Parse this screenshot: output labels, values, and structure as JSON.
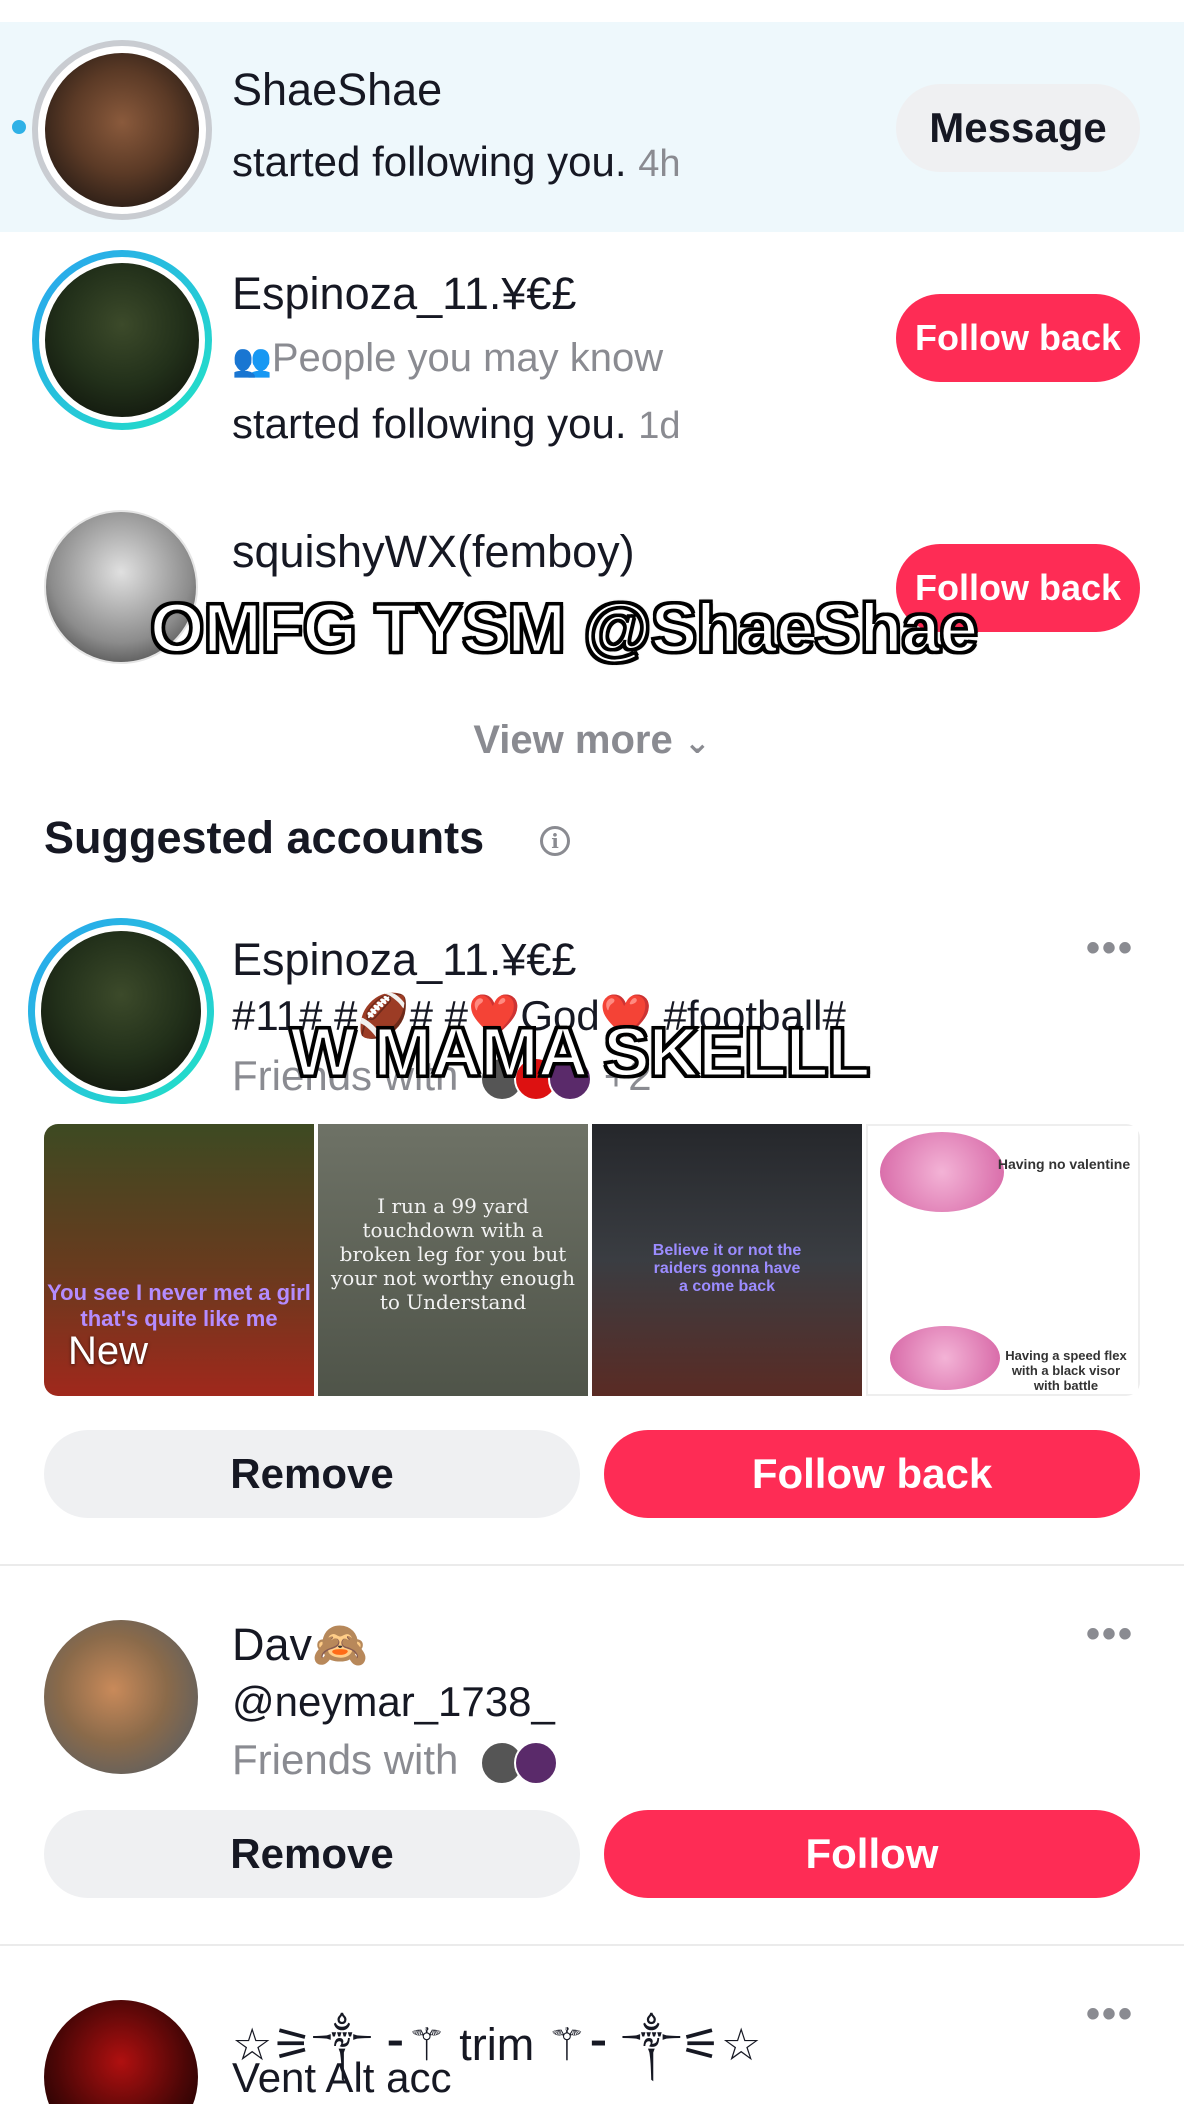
{
  "notifications": [
    {
      "name": "ShaeShae",
      "text": "started following you.",
      "time": "4h",
      "button": "Message"
    },
    {
      "name": "Espinoza_11.¥€£",
      "context": "People you may know",
      "text": "started following you.",
      "time": "1d",
      "button": "Follow back"
    },
    {
      "name": "squishyWX(femboy)",
      "button": "Follow back"
    }
  ],
  "view_more": "View more",
  "suggested": {
    "title": "Suggested accounts",
    "accounts": [
      {
        "name": "Espinoza_11.¥€£",
        "bio": "#11# #🏈# #❤️God❤️ #football#",
        "friends_prefix": "Friends with",
        "friends_more": "+2",
        "thumb_new_label": "New",
        "thumb1_caption": "You see I never met a girl that's quite like me",
        "thumb2_caption": "I run a 99 yard touchdown with a broken leg for you but your not worthy enough to Understand",
        "thumb3_caption": "Believe it or not the raiders gonna have a come back",
        "thumb4_caption_top": "Having no valentine",
        "thumb4_caption_bottom": "Having a speed flex with a black visor with battle mouthpiece",
        "remove": "Remove",
        "follow": "Follow back"
      },
      {
        "name": "Dav🙈",
        "handle": "@neymar_1738_",
        "friends_prefix": "Friends with",
        "remove": "Remove",
        "follow": "Follow"
      },
      {
        "name": "☆⚞༒ ⁃⚚ trim ⚚⁃ ༒⚟☆",
        "bio": "Vent Alt acc"
      }
    ]
  },
  "overlays": {
    "caption1": "OMFG TYSM @ShaeShae",
    "caption2": "W MAMA SKELLL"
  },
  "icons": {
    "people": "people-icon",
    "info": "info-icon",
    "chevron": "chevron-down-icon",
    "more": "more-dots-icon"
  },
  "colors": {
    "accent": "#fe2c55",
    "unread": "#2fb1e6",
    "highlight_bg": "#eef8fc"
  }
}
